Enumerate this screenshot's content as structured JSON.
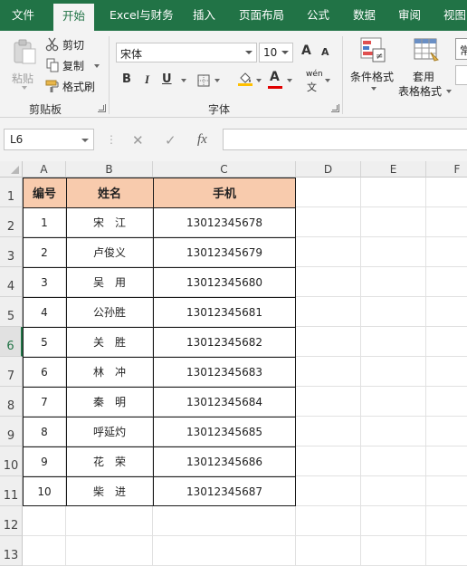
{
  "tabs": [
    "文件",
    "开始",
    "Excel与财务",
    "插入",
    "页面布局",
    "公式",
    "数据",
    "审阅",
    "视图"
  ],
  "clipboard": {
    "paste": "粘贴",
    "cut": "剪切",
    "copy": "复制",
    "format_painter": "格式刷",
    "group": "剪贴板"
  },
  "font": {
    "name": "宋体",
    "size": "10",
    "grow": "A",
    "shrink": "A",
    "bold": "B",
    "italic": "I",
    "underline": "U",
    "color_letter": "A",
    "phonetic": "wén",
    "group": "字体"
  },
  "styles": {
    "conditional": "条件格式",
    "table_line1": "套用",
    "table_line2": "表格格式",
    "gallery_peek": "常"
  },
  "formula_bar": {
    "name_box": "L6",
    "cancel": "✕",
    "enter": "✓",
    "fx": "fx",
    "content": ""
  },
  "columns": [
    "A",
    "B",
    "C",
    "D",
    "E",
    "F"
  ],
  "rows": [
    "1",
    "2",
    "3",
    "4",
    "5",
    "6",
    "7",
    "8",
    "9",
    "10",
    "11",
    "12",
    "13"
  ],
  "selected_row": "6",
  "table": {
    "headers": [
      "编号",
      "姓名",
      "手机"
    ],
    "rows": [
      [
        "1",
        "宋　江",
        "13012345678"
      ],
      [
        "2",
        "卢俊义",
        "13012345679"
      ],
      [
        "3",
        "吴　用",
        "13012345680"
      ],
      [
        "4",
        "公孙胜",
        "13012345681"
      ],
      [
        "5",
        "关　胜",
        "13012345682"
      ],
      [
        "6",
        "林　冲",
        "13012345683"
      ],
      [
        "7",
        "秦　明",
        "13012345684"
      ],
      [
        "8",
        "呼延灼",
        "13012345685"
      ],
      [
        "9",
        "花　荣",
        "13012345686"
      ],
      [
        "10",
        "柴　进",
        "13012345687"
      ]
    ]
  },
  "colors": {
    "ribbon_green": "#217346",
    "header_fill": "#f8cbad",
    "selection_green": "#217346"
  }
}
